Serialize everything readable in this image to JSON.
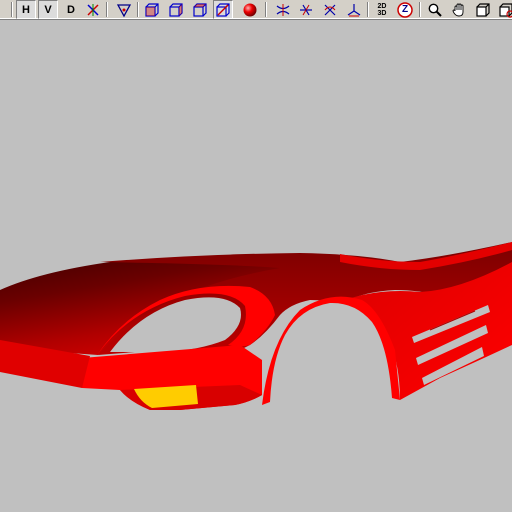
{
  "toolbar": {
    "view_h_label": "H",
    "view_v_label": "V",
    "view_d_label": "D",
    "mode_2d_label": "2D",
    "mode_3d_label": "3D",
    "zoom_z_label": "Z"
  },
  "viewport": {
    "background": "#c0c0c0",
    "model_colors": {
      "body_red": "#ff0000",
      "body_dark": "#7a0000",
      "body_darkest": "#4a0000",
      "light_yellow": "#ffcc00"
    }
  }
}
